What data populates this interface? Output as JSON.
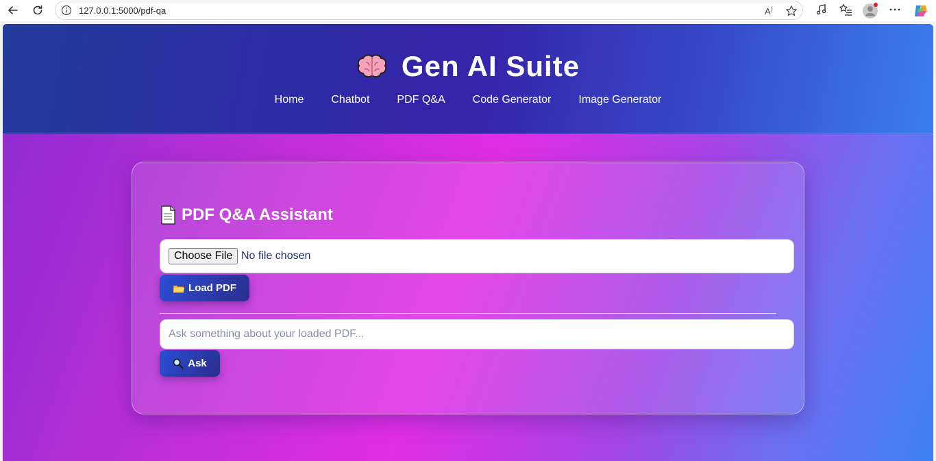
{
  "browser": {
    "url": "127.0.0.1:5000/pdf-qa"
  },
  "header": {
    "title": "Gen AI Suite",
    "nav": [
      {
        "label": "Home"
      },
      {
        "label": "Chatbot"
      },
      {
        "label": "PDF Q&A"
      },
      {
        "label": "Code Generator"
      },
      {
        "label": "Image Generator"
      }
    ]
  },
  "card": {
    "title": "PDF Q&A Assistant",
    "file_button_label": "Choose File",
    "file_status": "No file chosen",
    "load_button_label": "Load PDF",
    "question_placeholder": "Ask something about your loaded PDF...",
    "ask_button_label": "Ask"
  },
  "colors": {
    "header_gradient_start": "#243c9c",
    "header_gradient_end": "#3b7ef0",
    "page_gradient_mid": "#e22ee6",
    "button": "#2b3aa8"
  }
}
